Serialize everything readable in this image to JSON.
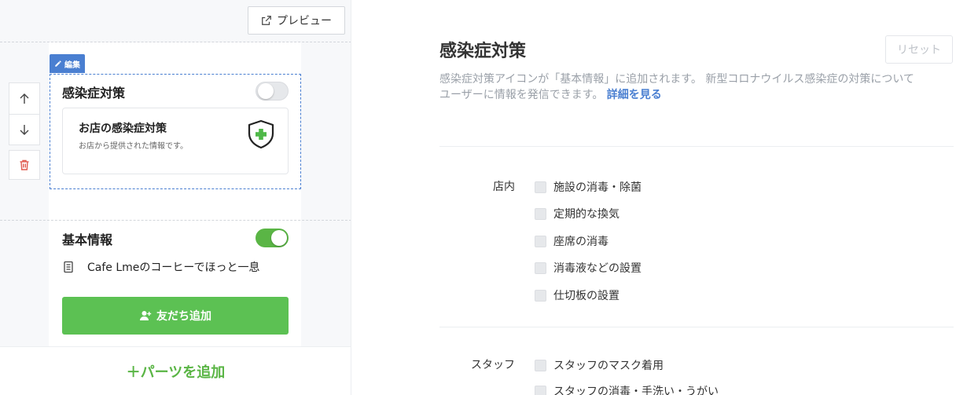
{
  "preview": {
    "button_label": "プレビュー"
  },
  "editor": {
    "edit_tag": "編集",
    "infection_block": {
      "title": "感染症対策",
      "enabled": false,
      "card_title": "お店の感染症対策",
      "card_subtitle": "お店から提供された情報です。"
    },
    "basic_block": {
      "title": "基本情報",
      "enabled": true,
      "description": "Cafe Lmeのコーヒーでほっと一息",
      "add_friend_label": "友だち追加"
    },
    "add_parts_label": "＋パーツを追加"
  },
  "settings": {
    "title": "感染症対策",
    "reset_label": "リセット",
    "description_line1": "感染症対策アイコンが「基本情報」に追加されます。 新型コロナウイルス感染症の対策について",
    "description_line2": "ユーザーに情報を発信できます。",
    "details_link": "詳細を見る",
    "groups": [
      {
        "label": "店内",
        "items": [
          "施設の消毒・除菌",
          "定期的な換気",
          "座席の消毒",
          "消毒液などの設置",
          "仕切板の設置"
        ]
      },
      {
        "label": "スタッフ",
        "items": [
          "スタッフのマスク着用",
          "スタッフの消毒・手洗い・うがい"
        ]
      }
    ]
  },
  "colors": {
    "accent_blue": "#4a7fd1",
    "accent_green": "#5ab545",
    "button_green": "#5cc153"
  }
}
